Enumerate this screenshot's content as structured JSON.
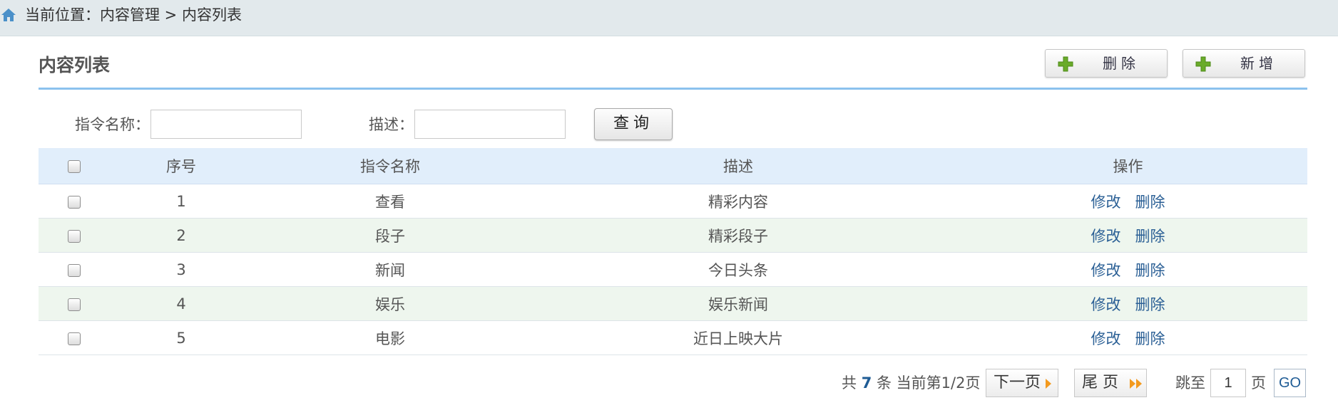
{
  "breadcrumb": "当前位置：内容管理 > 内容列表",
  "page_title": "内容列表",
  "toolbar": {
    "delete_label": "删除",
    "add_label": "新增"
  },
  "filters": {
    "command_label": "指令名称：",
    "command_value": "",
    "desc_label": "描述：",
    "desc_value": "",
    "query_label": "查询"
  },
  "table": {
    "headers": [
      "序号",
      "指令名称",
      "描述",
      "操作"
    ],
    "rows": [
      {
        "no": "1",
        "name": "查看",
        "desc": "精彩内容"
      },
      {
        "no": "2",
        "name": "段子",
        "desc": "精彩段子"
      },
      {
        "no": "3",
        "name": "新闻",
        "desc": "今日头条"
      },
      {
        "no": "4",
        "name": "娱乐",
        "desc": "娱乐新闻"
      },
      {
        "no": "5",
        "name": "电影",
        "desc": "近日上映大片"
      }
    ],
    "edit_label": "修改",
    "delete_label": "删除"
  },
  "pagination": {
    "total_prefix": "共",
    "total_count": "7",
    "total_suffix": "条 当前第1/2页",
    "next_label": "下一页",
    "last_label": "尾 页",
    "jump_label": "跳至",
    "page_value": "1",
    "page_unit": "页",
    "go_label": "GO"
  },
  "icons": {
    "breadcrumb": "home-icon",
    "toolbar": "plus-icon",
    "next": "arrow-right-icon",
    "last": "double-arrow-right-icon"
  },
  "colors": {
    "accent_line": "#8cc2ee",
    "header_bg": "#e1eefb",
    "alt_row": "#eef6ee",
    "link": "#2a5f95",
    "plus_green": "#6aab2a",
    "arrow_orange": "#f39a1e"
  }
}
